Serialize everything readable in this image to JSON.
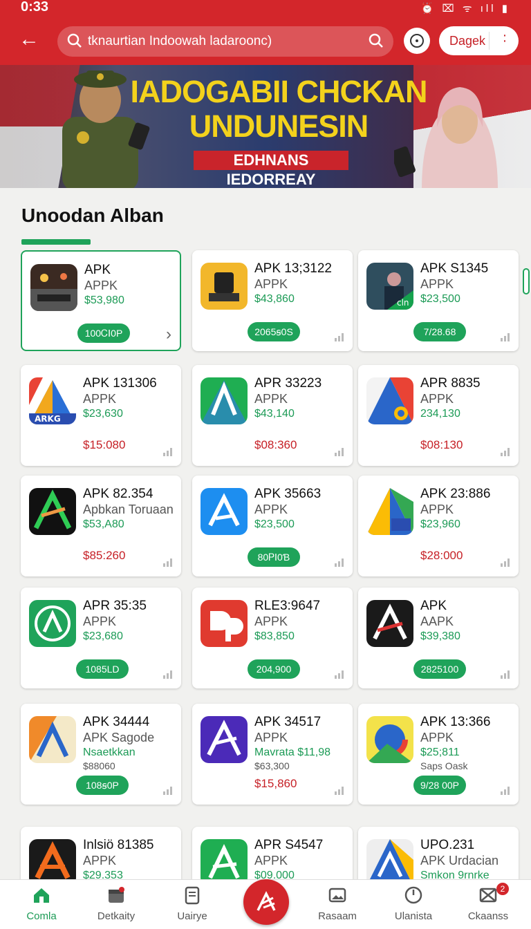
{
  "status": {
    "time": "0:33",
    "icons": "⏰ ⌧ ᯤ ıll ▮"
  },
  "appbar": {
    "search_text": "tknaurtian Indoowah ladaroonc)",
    "account_label": "Dagek"
  },
  "banner": {
    "title": "IADOGABII CHCKAN UNDUNESIN",
    "subtitle": "EDHNANS IEDORREAY"
  },
  "section": {
    "title": "Unoodan Alban"
  },
  "cards": [
    {
      "title": "APK",
      "sub": "APPK",
      "price": "$53,980",
      "button": "100ᏟⅠ0P",
      "icon": "photo-scene-icon",
      "selected": true
    },
    {
      "title": "APK 13;3122",
      "sub": "APPK",
      "price": "$43,860",
      "button": "2065ꞩ0S",
      "icon": "robot-arm-icon"
    },
    {
      "title": "APK S1345",
      "sub": "APPK",
      "price": "$23,500",
      "button": "7/28.68",
      "icon": "person-photo-icon"
    },
    {
      "title": "APK 131306",
      "sub": "APPK",
      "price": "$23,630",
      "red": "$15:080",
      "icon": "colorful-a-icon"
    },
    {
      "title": "APR 33223",
      "sub": "APPK",
      "price": "$43,140",
      "red": "$08:360",
      "icon": "green-a-icon"
    },
    {
      "title": "APR 8835",
      "sub": "APPK",
      "price": "234,130",
      "red": "$08:130",
      "icon": "triangle-chrome-icon"
    },
    {
      "title": "APK 82.354",
      "sub": "Apbkan Toruaan",
      "price": "$53,A80",
      "red": "$85:260",
      "icon": "black-a-icon"
    },
    {
      "title": "APK 35663",
      "sub": "APPK",
      "price": "$23,500",
      "button": "80ᏢⅠ0Ɓ",
      "icon": "blue-a-icon"
    },
    {
      "title": "APK 23:886",
      "sub": "APPK",
      "price": "$23,960",
      "red": "$28:000",
      "icon": "multicolor-a-icon"
    },
    {
      "title": "APR 35:35",
      "sub": "APPK",
      "price": "$23,680",
      "button": "1085LD",
      "icon": "green-circle-a-icon"
    },
    {
      "title": "RLE3:9647",
      "sub": "APPK",
      "price": "$83,850",
      "button": "204,900",
      "icon": "red-dp-icon"
    },
    {
      "title": "APK",
      "sub": "AAPK",
      "price": "$39,380",
      "button": "2825100",
      "icon": "dark-a-icon"
    },
    {
      "title": "APK 34444",
      "sub": "APK Sagode",
      "price": "Nsaetkkan",
      "price2": "$88060",
      "button": "108ꞩ0P",
      "icon": "orange-a-icon"
    },
    {
      "title": "APK 34517",
      "sub": "APPK",
      "price": "Mavrata $11,98",
      "price2": "$63,300",
      "red": "$15,860",
      "icon": "purple-a-icon"
    },
    {
      "title": "APK 13:366",
      "sub": "APPK",
      "price": "$25;811",
      "price2": "Saps Oask",
      "button": "9/28 00P",
      "icon": "chrome-like-icon"
    },
    {
      "title": "Inlsiö 81385",
      "sub": "APPK",
      "price": "$29.353",
      "icon": "orange-x-icon"
    },
    {
      "title": "APR S4547",
      "sub": "APPK",
      "price": "$09.000",
      "icon": "green-a2-icon"
    },
    {
      "title": "UPO.231",
      "sub": "APK Urdacian",
      "price": "Smkon 9rnrke",
      "icon": "blue-a2-icon"
    }
  ],
  "bottom_nav": [
    {
      "label": "Comla",
      "icon": "home-icon",
      "active": true
    },
    {
      "label": "Detkaity",
      "icon": "calendar-icon"
    },
    {
      "label": "Uairye",
      "icon": "document-icon"
    },
    {
      "label": "",
      "icon": "center-action-icon"
    },
    {
      "label": "Rasaam",
      "icon": "image-icon"
    },
    {
      "label": "Ulanista",
      "icon": "clock-icon"
    },
    {
      "label": "Ckaanss",
      "icon": "grid-icon",
      "badge": "2"
    }
  ],
  "colors": {
    "brand_red": "#d3262b",
    "accent_green": "#1fa35a",
    "price_green": "#1b9a55",
    "price_red": "#c62026"
  }
}
